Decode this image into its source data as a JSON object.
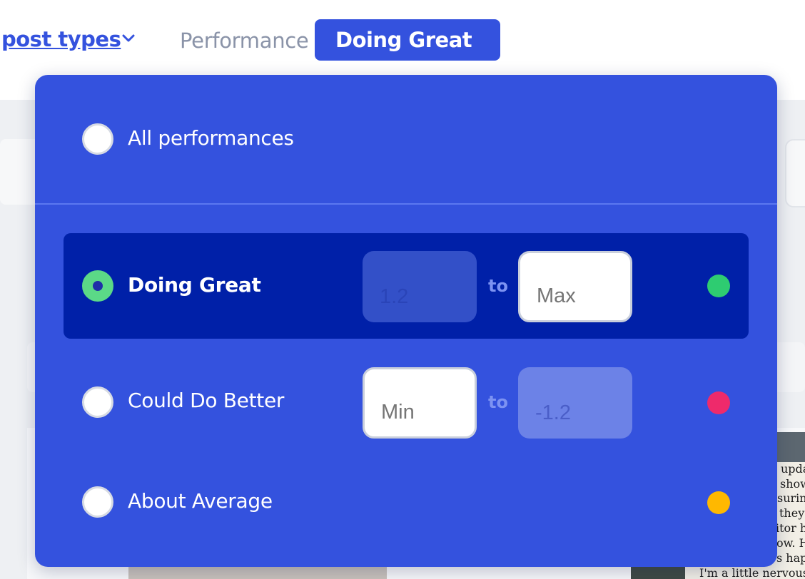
{
  "header": {
    "post_types_label": "post types",
    "performance_label": "Performance",
    "active_filter_chip": "Doing Great"
  },
  "dropdown": {
    "all_option": "All performances",
    "options": [
      {
        "label": "Doing Great",
        "selected": true,
        "min_value": "1.2",
        "to_label": "to",
        "max_value": "",
        "max_placeholder": "Max",
        "dot_color": "#2ecc71"
      },
      {
        "label": "Could Do Better",
        "selected": false,
        "min_value": "",
        "min_placeholder": "Min",
        "to_label": "to",
        "max_value": "-1.2",
        "dot_color": "#ee2a6b"
      },
      {
        "label": "About Average",
        "selected": false,
        "dot_color": "#ffb800"
      }
    ]
  },
  "background": {
    "article_lines": [
      "upda",
      "show",
      "suring",
      "they",
      "itor h",
      "ow. H",
      "s happ",
      "I'm a little nervous"
    ]
  },
  "colors": {
    "accent": "#3452de",
    "selected_row": "#0020a8",
    "selected_radio": "#5bd987"
  }
}
